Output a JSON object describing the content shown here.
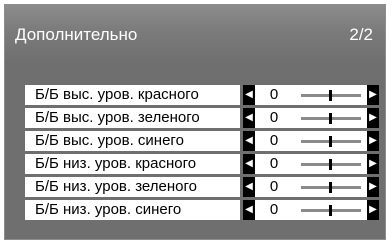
{
  "header": {
    "title": "Дополнительно",
    "page_indicator": "2/2"
  },
  "icons": {
    "left": "arrow-left-icon",
    "right": "arrow-right-icon"
  },
  "rows": [
    {
      "label": "Б/Б выс. уров. красного",
      "value": "0"
    },
    {
      "label": "Б/Б выс. уров. зеленого",
      "value": "0"
    },
    {
      "label": "Б/Б выс. уров. синего",
      "value": "0"
    },
    {
      "label": "Б/Б низ. уров. красного",
      "value": "0"
    },
    {
      "label": "Б/Б низ. уров. зеленого",
      "value": "0"
    },
    {
      "label": "Б/Б низ. уров. синего",
      "value": "0"
    }
  ],
  "colors": {
    "panel_bg": "#6f6f6f",
    "label_bg": "#ffffff",
    "arrow_bg": "#000000"
  }
}
